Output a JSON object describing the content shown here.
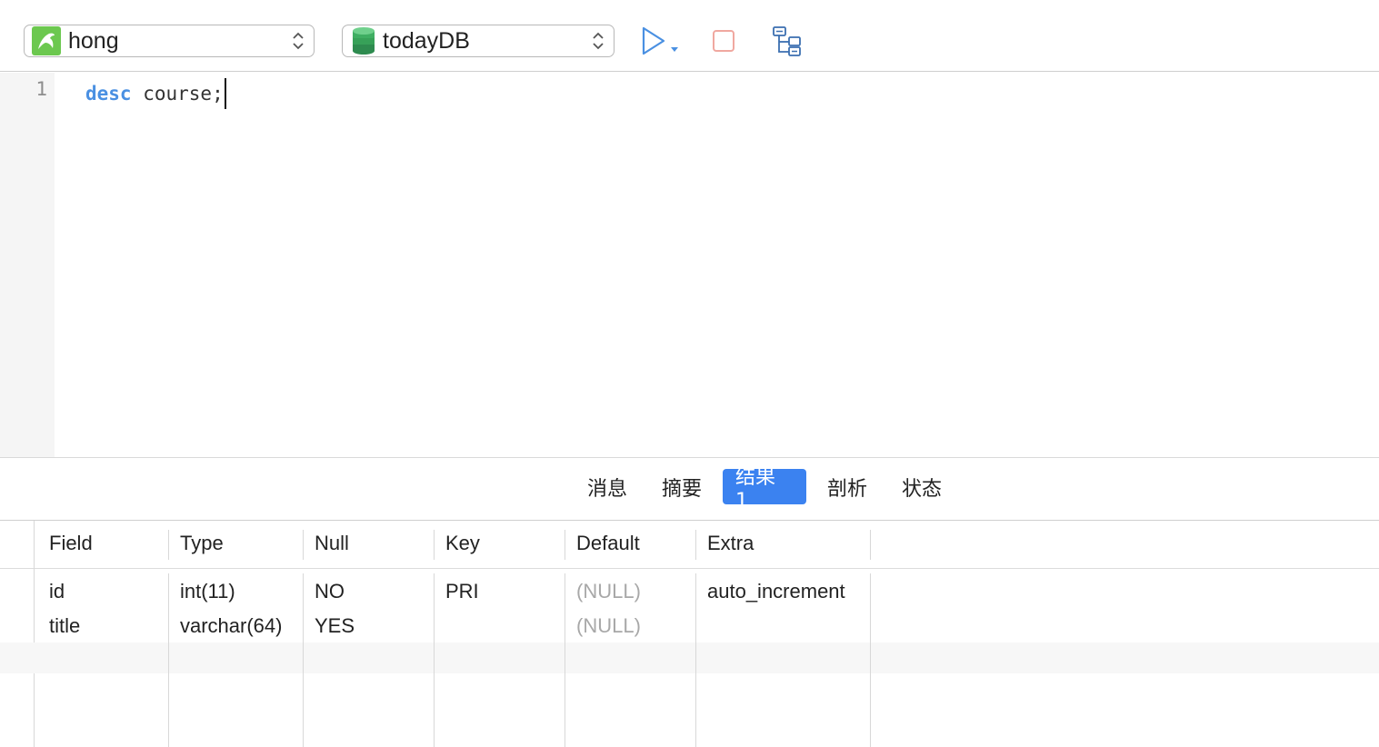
{
  "toolbar": {
    "connection": {
      "label": "hong",
      "icon": "mysql-dolphin-icon",
      "icon_color": "#6cc84f"
    },
    "database": {
      "label": "todayDB",
      "icon": "database-icon",
      "icon_color": "#3aa360"
    },
    "run_icon": "play-icon",
    "stop_icon": "stop-icon",
    "explain_icon": "explain-tree-icon",
    "accent_color": "#4a90e2"
  },
  "editor": {
    "line_number": "1",
    "keyword": "desc",
    "rest": " course;"
  },
  "tabs": [
    {
      "label": "消息",
      "active": false
    },
    {
      "label": "摘要",
      "active": false
    },
    {
      "label": "结果 1",
      "active": true
    },
    {
      "label": "剖析",
      "active": false
    },
    {
      "label": "状态",
      "active": false
    }
  ],
  "results": {
    "columns": [
      "Field",
      "Type",
      "Null",
      "Key",
      "Default",
      "Extra"
    ],
    "rows": [
      [
        "id",
        "int(11)",
        "NO",
        "PRI",
        "(NULL)",
        "auto_increment"
      ],
      [
        "title",
        "varchar(64)",
        "YES",
        "",
        "(NULL)",
        ""
      ]
    ]
  }
}
